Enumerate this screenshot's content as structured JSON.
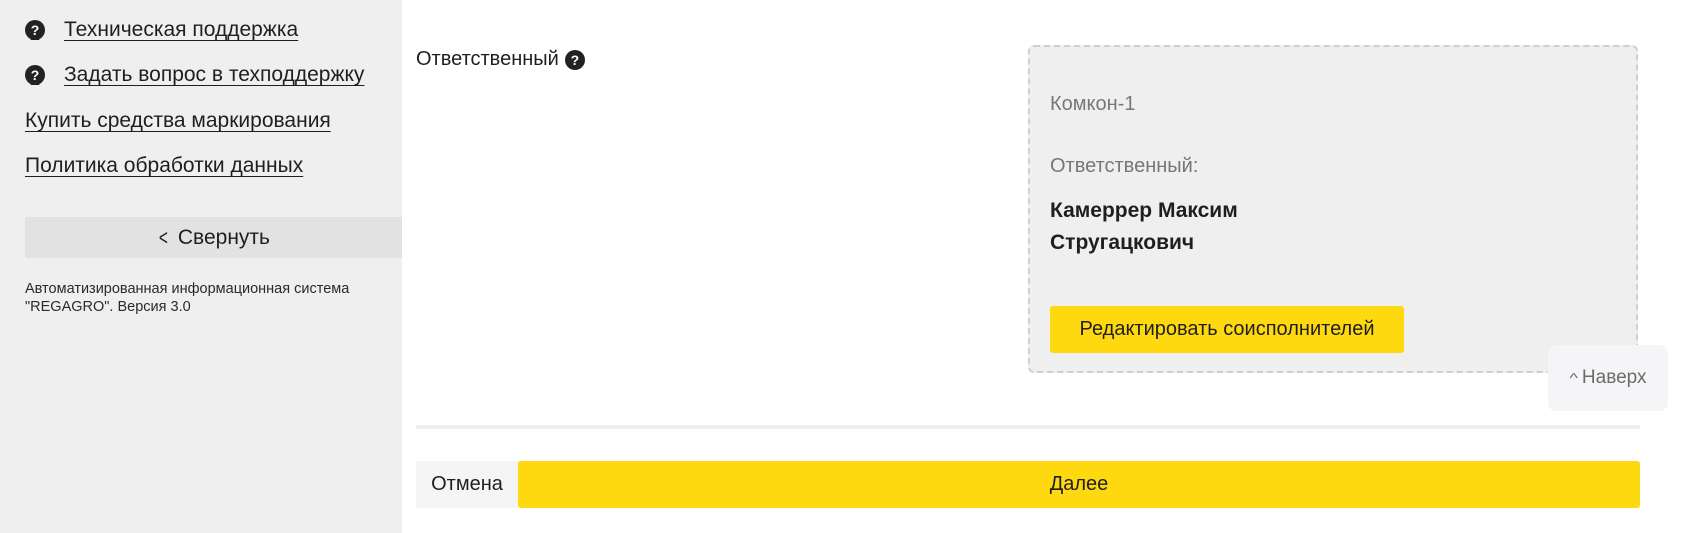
{
  "sidebar": {
    "links": [
      {
        "label": "Техническая поддержка",
        "icon": "help-circle-icon"
      },
      {
        "label": "Задать вопрос в техподдержку",
        "icon": "help-circle-icon"
      },
      {
        "label": "Купить средства маркирования"
      },
      {
        "label": "Политика обработки данных"
      }
    ],
    "icon_glyph": "?",
    "collapse_label": "Свернуть",
    "collapse_icon": "chevron-left-icon",
    "system_info": "Автоматизированная информационная система \"REGAGRO\". Версия 3.0"
  },
  "form": {
    "field_label": "Ответственный",
    "field_help_icon": "help-circle-icon",
    "card": {
      "organization": "Комкон-1",
      "role_label": "Ответственный:",
      "person_name": "Камеррер Максим Стругацкович",
      "edit_button": "Редактировать соисполнителей"
    }
  },
  "scroll_top": {
    "label": "Наверх",
    "icon": "chevron-up-icon"
  },
  "footer": {
    "cancel_label": "Отмена",
    "next_label": "Далее"
  },
  "colors": {
    "accent": "#ffd90f",
    "sidebar_bg": "#efefef",
    "card_bg": "#efefef"
  }
}
